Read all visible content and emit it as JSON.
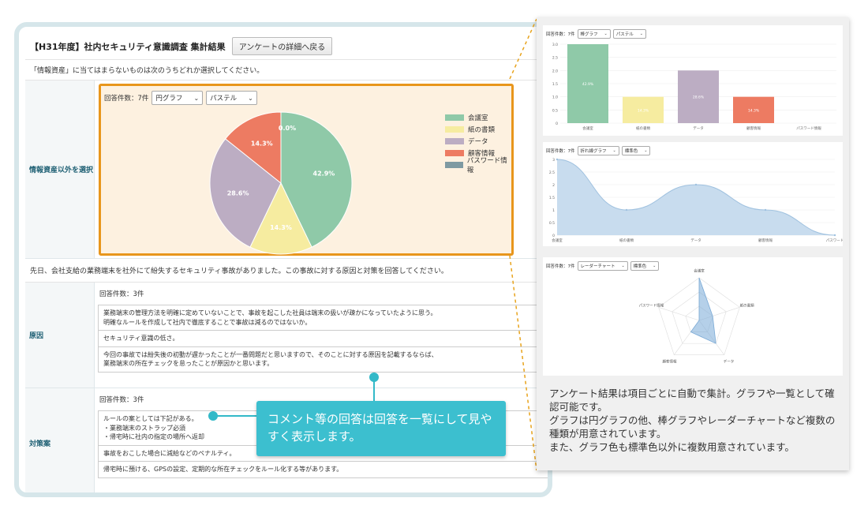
{
  "header": {
    "title": "【H31年度】社内セキュリティ意識調査 集計結果",
    "back_button": "アンケートの詳細へ戻る"
  },
  "question1": {
    "text": "「情報資産」に当てはまらないものは次のうちどれか選択してください。",
    "row_label": "情報資産以外を選択",
    "count_label": "回答件数：7件",
    "chart_type_select": "円グラフ",
    "color_select": "パステル"
  },
  "chart_data": {
    "type": "pie",
    "categories": [
      "会議室",
      "紙の書類",
      "データ",
      "顧客情報",
      "パスワード情報"
    ],
    "values": [
      42.9,
      14.3,
      28.6,
      14.3,
      0.0
    ],
    "value_labels": [
      "42.9%",
      "14.3%",
      "28.6%",
      "14.3%",
      "0.0%"
    ],
    "colors": [
      "#8fc9a8",
      "#f6eca0",
      "#bcadc3",
      "#ed7b62",
      "#7f9aa2"
    ],
    "legend_position": "right"
  },
  "question2": {
    "text": "先日、会社支給の業務端末を社外にて紛失するセキュリティ事故がありました。この事故に対する原因と対策を回答してください。",
    "cause": {
      "row_label": "原因",
      "count_label": "回答件数：3件",
      "answers": [
        "業務端末の管理方法を明確に定めていないことで、事故を起こした社員は端末の扱いが疎かになっていたように思う。\n明確なルールを作成して社内で徹底することで事故は減るのではないか。",
        "セキュリティ意識の低さ。",
        "今回の事故では紛失後の初動が遅かったことが一番問題だと思いますので、そのことに対する原因を記載するならば、\n業務端末の所在チェックを怠ったことが原因かと思います。"
      ]
    },
    "measure": {
      "row_label": "対策案",
      "count_label": "回答件数：3件",
      "answers": [
        "ルールの案としては下記がある。\n・業務端末のストラップ必須\n・帰宅時に社内の指定の場所へ返却",
        "事故をおこした場合に減給などのペナルティ。",
        "帰宅時に預ける、GPSの設定、定期的な所在チェックをルール化する等があります。"
      ]
    }
  },
  "callout": {
    "text": "コメント等の回答は回答を一覧にして見やすく表示します。"
  },
  "mini_charts": {
    "bar": {
      "count_label": "回答件数：7件",
      "type_select": "棒グラフ",
      "color_select": "パステル",
      "categories": [
        "会議室",
        "紙の書類",
        "データ",
        "顧客情報",
        "パスワード情報"
      ],
      "values": [
        3,
        1,
        2,
        1,
        0
      ],
      "value_labels": [
        "42.9%",
        "14.3%",
        "28.6%",
        "14.3%",
        ""
      ],
      "colors": [
        "#8fc9a8",
        "#f6eca0",
        "#bcadc3",
        "#ed7b62",
        "#7f9aa2"
      ],
      "y_ticks": [
        "3.0",
        "2.5",
        "2.0",
        "1.5",
        "1.0",
        "0.5",
        "0"
      ]
    },
    "line": {
      "count_label": "回答件数：7件",
      "type_select": "折れ線グラフ",
      "color_select": "標準色",
      "categories": [
        "会議室",
        "紙の書類",
        "データ",
        "顧客情報",
        "パスワード"
      ],
      "values": [
        3,
        1,
        2,
        1,
        0
      ],
      "y_ticks": [
        "3",
        "2.5",
        "2",
        "1.5",
        "1",
        "0.5",
        "0"
      ]
    },
    "radar": {
      "count_label": "回答件数：7件",
      "type_select": "レーダーチャート",
      "color_select": "標準色",
      "categories": [
        "会議室",
        "紙の書類",
        "データ",
        "顧客情報",
        "パスワード情報"
      ],
      "values": [
        3,
        1,
        2,
        1,
        0
      ]
    }
  },
  "description": {
    "text": "アンケート結果は項目ごとに自動で集計。グラフや一覧として確認可能です。\nグラフは円グラフの他、棒グラフやレーダーチャートなど複数の種類が用意されています。\nまた、グラフ色も標準色以外に複数用意されています。"
  }
}
